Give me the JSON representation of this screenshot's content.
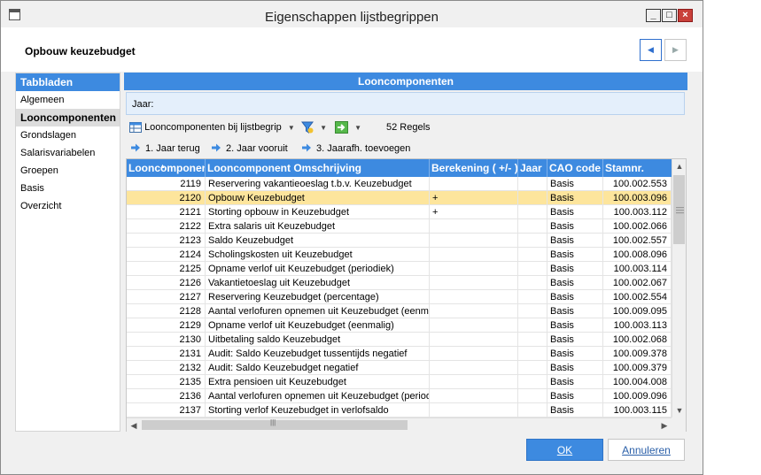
{
  "window": {
    "title": "Eigenschappen lijstbegrippen"
  },
  "header": {
    "title": "Opbouw keuzebudget"
  },
  "sidebar": {
    "title": "Tabbladen",
    "items": [
      {
        "label": "Algemeen"
      },
      {
        "label": "Looncomponenten",
        "active": true
      },
      {
        "label": "Grondslagen"
      },
      {
        "label": "Salarisvariabelen"
      },
      {
        "label": "Groepen"
      },
      {
        "label": "Basis"
      },
      {
        "label": "Overzicht"
      }
    ]
  },
  "panel": {
    "title": "Looncomponenten"
  },
  "filter": {
    "jaar_label": "Jaar:"
  },
  "toolbar": {
    "looncomponenten_btn": "Looncomponenten bij lijstbegrip",
    "count": "52 Regels"
  },
  "actions": [
    {
      "label": "1. Jaar terug"
    },
    {
      "label": "2. Jaar vooruit"
    },
    {
      "label": "3. Jaarafh. toevoegen"
    }
  ],
  "table": {
    "columns": [
      "Looncomponent",
      "Looncomponent Omschrijving",
      "Berekening ( +/- )",
      "Jaar",
      "CAO code",
      "Stamnr."
    ],
    "rows": [
      {
        "nr": "2119",
        "desc": "Reservering vakantieoeslag t.b.v. Keuzebudget",
        "ber": "",
        "jaar": "",
        "cao": "Basis",
        "stamnr": "100.002.553"
      },
      {
        "nr": "2120",
        "desc": "Opbouw Keuzebudget",
        "ber": "+",
        "jaar": "",
        "cao": "Basis",
        "stamnr": "100.003.096",
        "selected": true
      },
      {
        "nr": "2121",
        "desc": "Storting opbouw in Keuzebudget",
        "ber": "+",
        "jaar": "",
        "cao": "Basis",
        "stamnr": "100.003.112"
      },
      {
        "nr": "2122",
        "desc": "Extra salaris uit Keuzebudget",
        "ber": "",
        "jaar": "",
        "cao": "Basis",
        "stamnr": "100.002.066"
      },
      {
        "nr": "2123",
        "desc": "Saldo Keuzebudget",
        "ber": "",
        "jaar": "",
        "cao": "Basis",
        "stamnr": "100.002.557"
      },
      {
        "nr": "2124",
        "desc": "Scholingskosten uit Keuzebudget",
        "ber": "",
        "jaar": "",
        "cao": "Basis",
        "stamnr": "100.008.096"
      },
      {
        "nr": "2125",
        "desc": "Opname verlof uit Keuzebudget (periodiek)",
        "ber": "",
        "jaar": "",
        "cao": "Basis",
        "stamnr": "100.003.114"
      },
      {
        "nr": "2126",
        "desc": "Vakantietoeslag uit Keuzebudget",
        "ber": "",
        "jaar": "",
        "cao": "Basis",
        "stamnr": "100.002.067"
      },
      {
        "nr": "2127",
        "desc": "Reservering Keuzebudget (percentage)",
        "ber": "",
        "jaar": "",
        "cao": "Basis",
        "stamnr": "100.002.554"
      },
      {
        "nr": "2128",
        "desc": "Aantal verlofuren opnemen uit Keuzebudget (eenmalig)",
        "ber": "",
        "jaar": "",
        "cao": "Basis",
        "stamnr": "100.009.095"
      },
      {
        "nr": "2129",
        "desc": "Opname verlof uit Keuzebudget (eenmalig)",
        "ber": "",
        "jaar": "",
        "cao": "Basis",
        "stamnr": "100.003.113"
      },
      {
        "nr": "2130",
        "desc": "Uitbetaling saldo Keuzebudget",
        "ber": "",
        "jaar": "",
        "cao": "Basis",
        "stamnr": "100.002.068"
      },
      {
        "nr": "2131",
        "desc": "Audit: Saldo Keuzebudget tussentijds negatief",
        "ber": "",
        "jaar": "",
        "cao": "Basis",
        "stamnr": "100.009.378"
      },
      {
        "nr": "2132",
        "desc": "Audit: Saldo Keuzebudget negatief",
        "ber": "",
        "jaar": "",
        "cao": "Basis",
        "stamnr": "100.009.379"
      },
      {
        "nr": "2135",
        "desc": "Extra pensioen uit Keuzebudget",
        "ber": "",
        "jaar": "",
        "cao": "Basis",
        "stamnr": "100.004.008"
      },
      {
        "nr": "2136",
        "desc": "Aantal verlofuren opnemen uit Keuzebudget (periodiek)",
        "ber": "",
        "jaar": "",
        "cao": "Basis",
        "stamnr": "100.009.096"
      },
      {
        "nr": "2137",
        "desc": "Storting verlof Keuzebudget in verlofsaldo",
        "ber": "",
        "jaar": "",
        "cao": "Basis",
        "stamnr": "100.003.115"
      }
    ]
  },
  "buttons": {
    "ok": "OK",
    "cancel": "Annuleren"
  },
  "colors": {
    "accent": "#3d8ae0",
    "selection": "#fde59c"
  }
}
